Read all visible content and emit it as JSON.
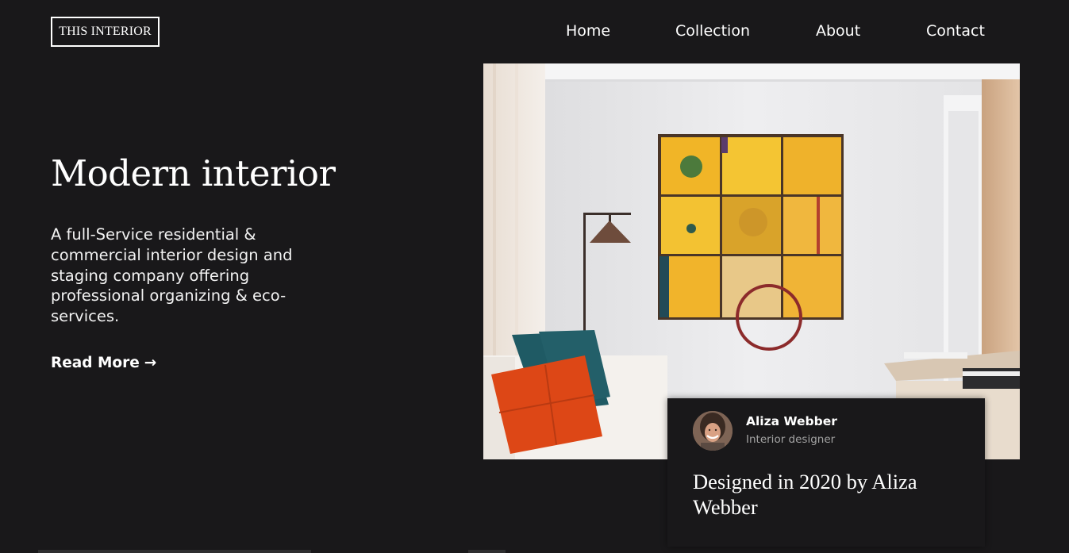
{
  "header": {
    "logo_text": "THIS INTERIOR",
    "nav": [
      {
        "label": "Home"
      },
      {
        "label": "Collection"
      },
      {
        "label": "About"
      },
      {
        "label": "Contact"
      }
    ]
  },
  "hero": {
    "title": "Modern interior",
    "description": "A full-Service residential & commercial interior design and staging company offering professional organizing & eco-services.",
    "read_more_label": "Read More",
    "read_more_arrow": "→"
  },
  "designer_card": {
    "name": "Aliza Webber",
    "role": "Interior designer",
    "quote": "Designed in 2020 by Aliza Webber"
  },
  "colors": {
    "background": "#19181a",
    "text": "#ffffff",
    "muted_text": "#a3a3a3"
  }
}
